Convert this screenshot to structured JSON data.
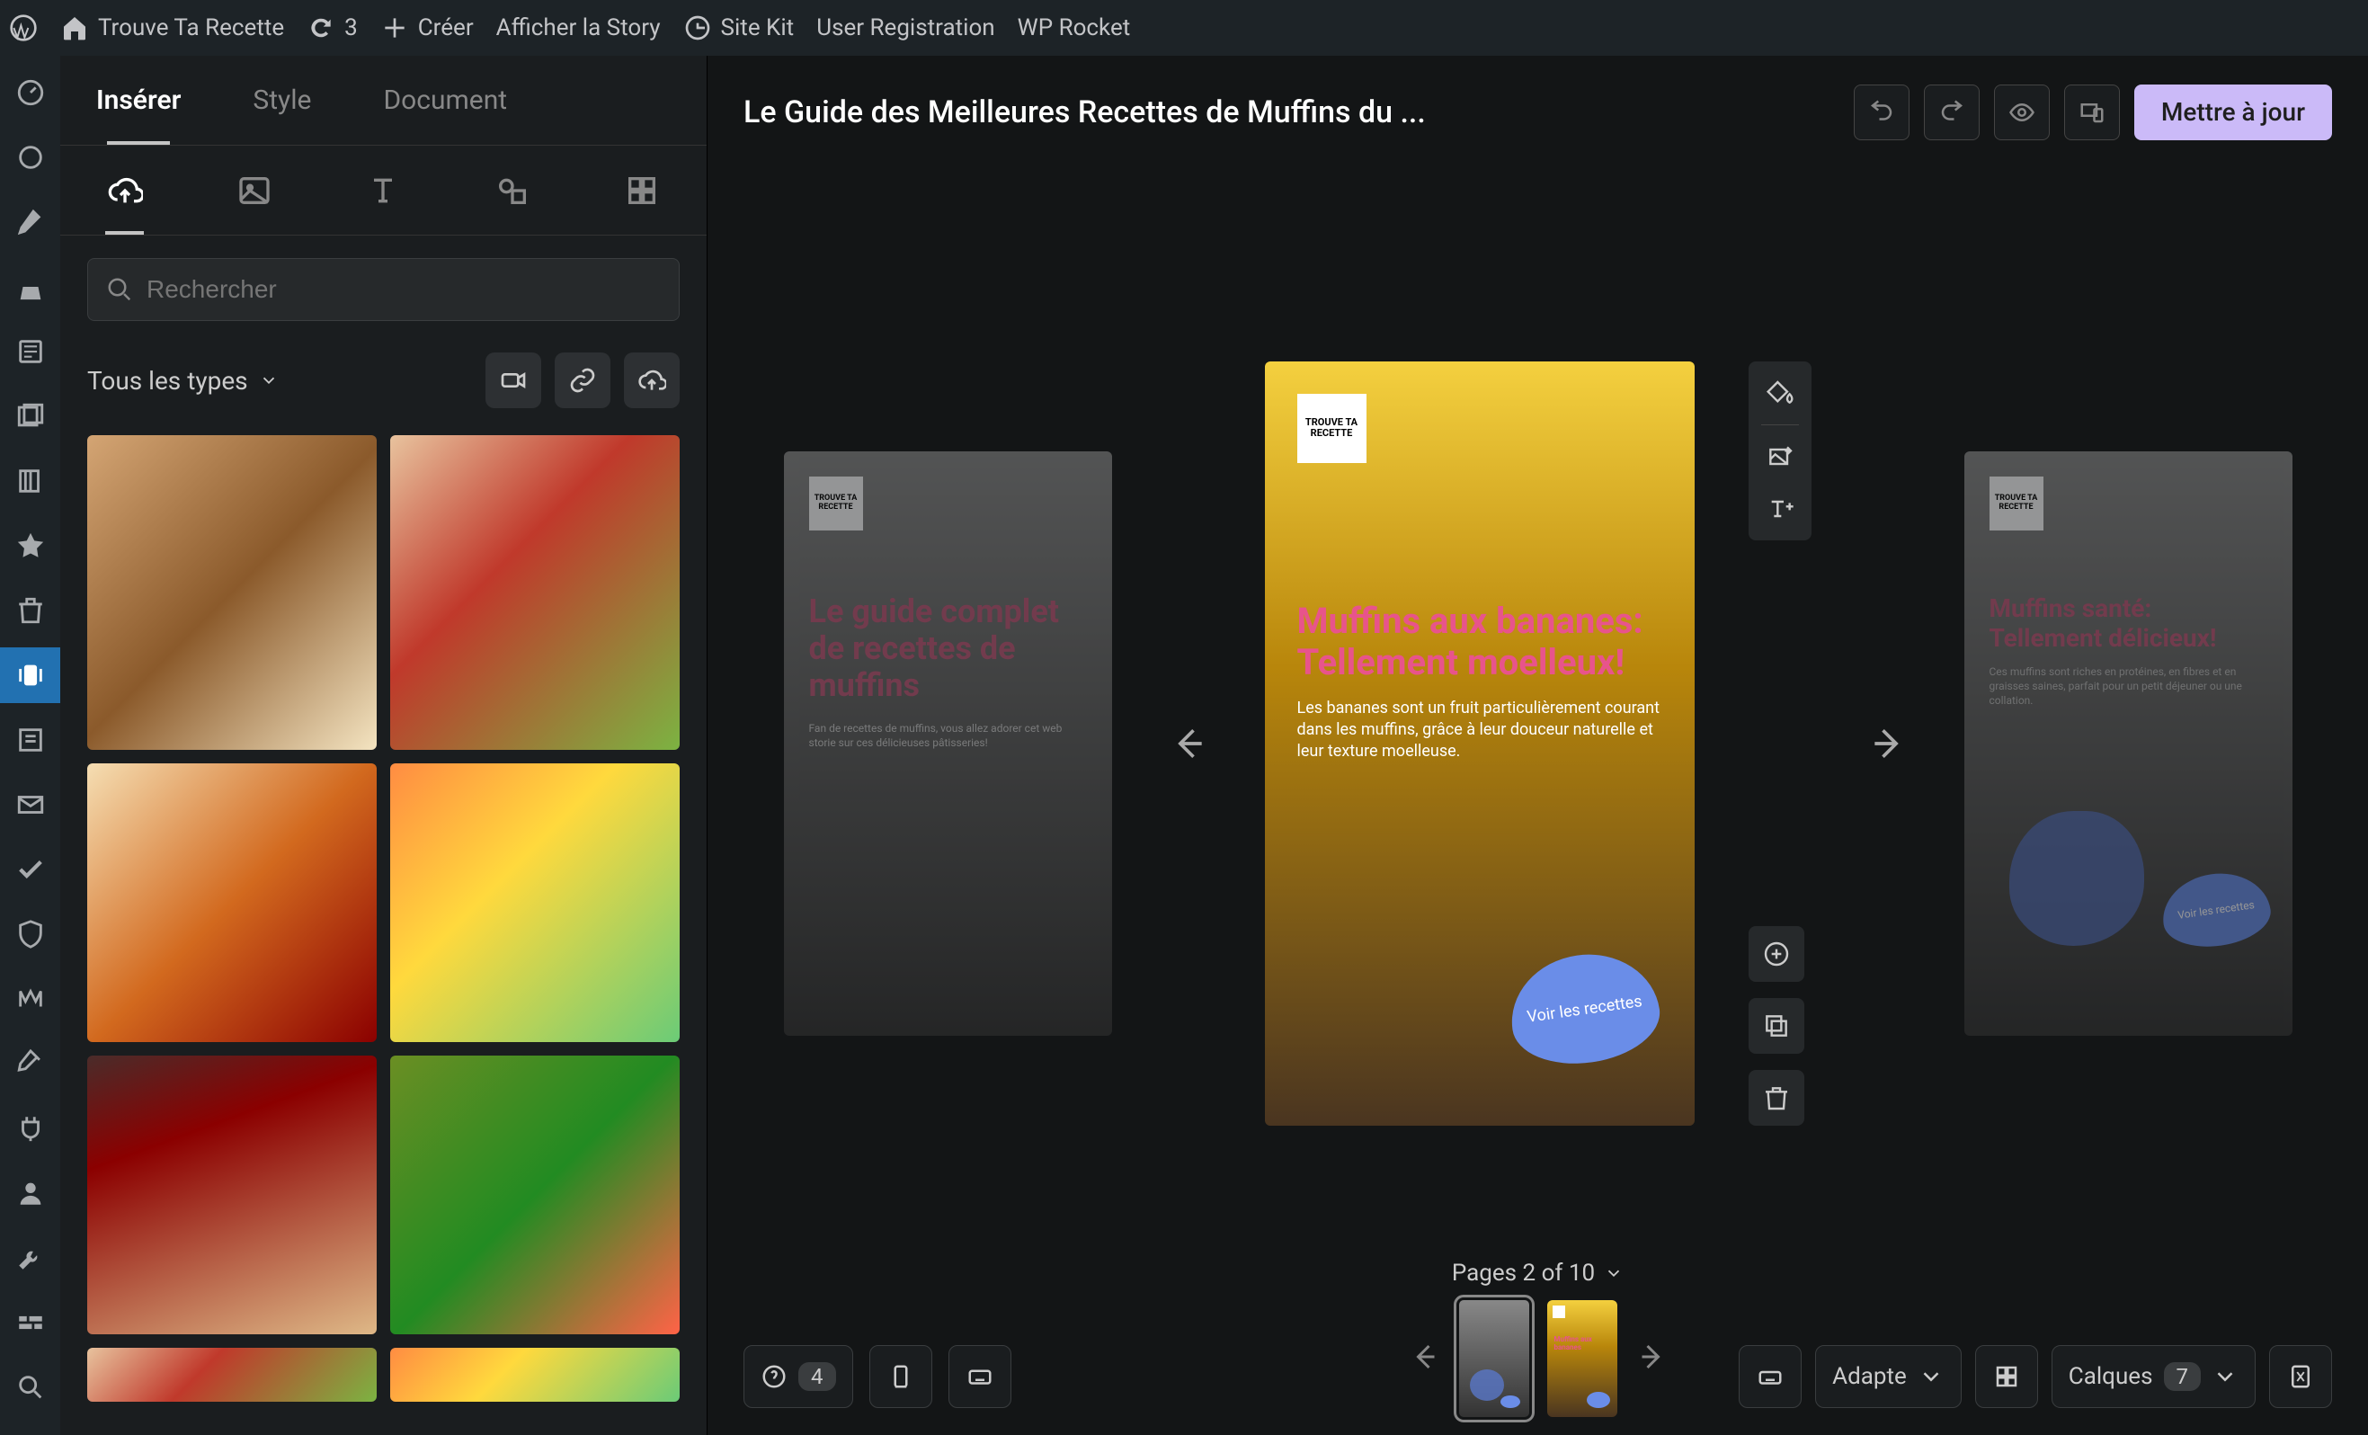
{
  "adminBar": {
    "siteName": "Trouve Ta Recette",
    "updateCount": "3",
    "newLabel": "Créer",
    "viewStory": "Afficher la Story",
    "siteKit": "Site Kit",
    "userReg": "User Registration",
    "wpRocket": "WP Rocket"
  },
  "panel": {
    "tabs": {
      "insert": "Insérer",
      "style": "Style",
      "document": "Document"
    },
    "search": {
      "placeholder": "Rechercher"
    },
    "filter": {
      "allTypes": "Tous les types"
    }
  },
  "header": {
    "title": "Le Guide des Meilleures Recettes de Muffins du ...",
    "updateBtn": "Mettre à jour"
  },
  "slides": {
    "logo": "TROUVE TA RECETTE",
    "s1": {
      "title": "Le guide complet de recettes de muffins",
      "sub": "Fan de recettes de muffins, vous allez adorer cet web storie sur ces délicieuses pâtisseries!"
    },
    "s2": {
      "title": "Muffins aux bananes: Tellement moelleux!",
      "sub": "Les bananes sont un fruit particulièrement courant dans les muffins, grâce à leur douceur naturelle et leur texture moelleuse.",
      "cta": "Voir les recettes"
    },
    "s3": {
      "title": "Muffins santé: Tellement délicieux!",
      "sub": "Ces muffins sont riches en protéines, en fibres et en graisses saines, parfait pour un petit déjeuner ou une collation.",
      "cta": "Voir les recettes"
    }
  },
  "footer": {
    "checklistCount": "4",
    "pagesLabel": "Pages 2 of 10",
    "adapte": "Adapte",
    "calques": "Calques",
    "calquesCount": "7"
  }
}
